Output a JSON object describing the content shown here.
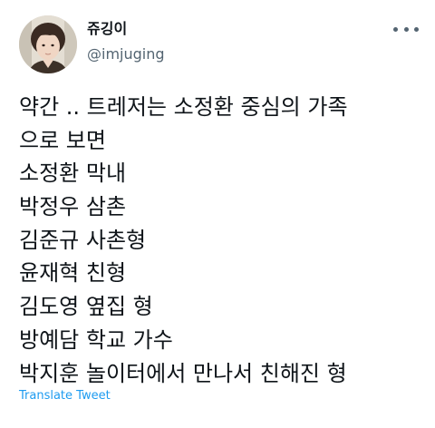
{
  "author": {
    "display_name": "쥬깅이",
    "handle": "@imjuging",
    "avatar_icon": "profile-photo-avatar"
  },
  "more_menu_icon": "more-horizontal-icon",
  "tweet": {
    "lines": [
      "약간 .. 트레저는 소정환 중심의 가족",
      "으로 보면",
      "소정환 막내",
      "박정우 삼촌",
      "김준규 사촌형",
      "윤재혁 친형",
      "김도영 옆집 형",
      "방예담 학교 가수",
      "박지훈 놀이터에서 만나서 친해진 형"
    ]
  },
  "translate_label": "Translate Tweet",
  "colors": {
    "text": "#0f1419",
    "secondary": "#536471",
    "link": "#1d9bf0"
  }
}
